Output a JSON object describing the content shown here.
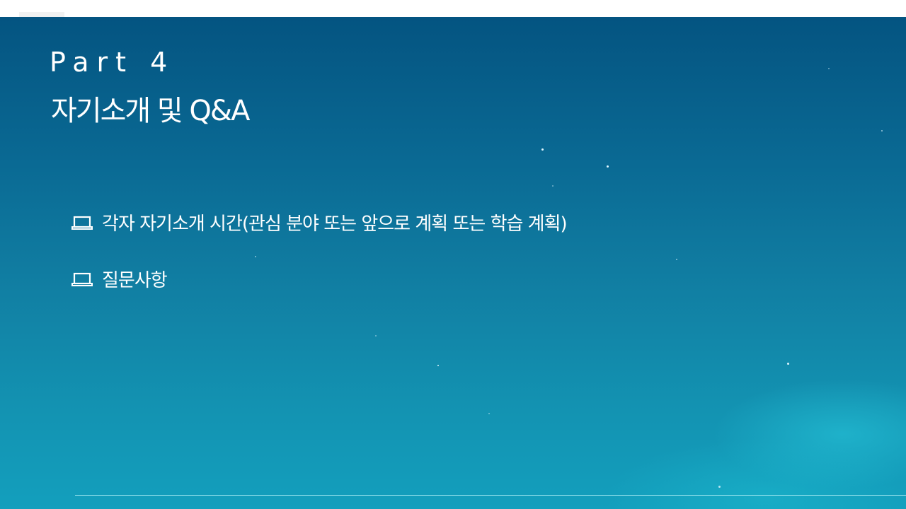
{
  "slide": {
    "part_label": "Part 4",
    "title": "자기소개 및 Q&A",
    "bullets": [
      {
        "icon": "laptop-icon",
        "text": "각자 자기소개 시간(관심 분야 또는 앞으로 계획 또는 학습 계획)"
      },
      {
        "icon": "laptop-icon",
        "text": "질문사항"
      }
    ]
  },
  "colors": {
    "background_top": "#045481",
    "background_bottom": "#139fbd",
    "text": "#ffffff",
    "footer_line": "#a9ecf3"
  }
}
